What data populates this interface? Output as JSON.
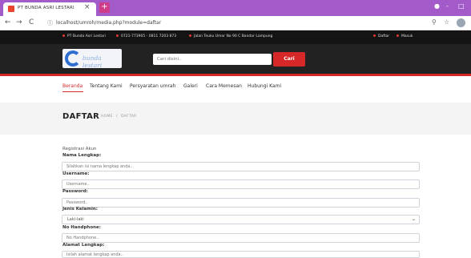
{
  "browser": {
    "tab_title": "PT BUNDA ASRI LESTARI",
    "tab_close": "×",
    "new_tab": "+",
    "url": "localhost/umroh/media.php?module=daftar",
    "back": "←",
    "forward": "→",
    "reload": "C",
    "url_icon": "ⓘ",
    "zoom_icon": "⚲",
    "star_icon": "☆",
    "win_minimize": "●",
    "win_restore": "-",
    "win_close": "□"
  },
  "infobar": {
    "company": "PT Bunda Asri Lestari",
    "phone": "0721-773905 - 0811 7203 873",
    "address": "Jalan Teuku Umar No 90 C Bandar Lampung",
    "register": "Daftar",
    "login": "Masuk"
  },
  "header": {
    "logo_text": "bunda lestari",
    "search_placeholder": "Cari disini..",
    "search_button": "Cari"
  },
  "menu": {
    "items": [
      "Beranda",
      "Tentang Kami",
      "Persyaratan umrah",
      "Galeri",
      "Cara Memesan",
      "Hubungi Kami"
    ]
  },
  "page": {
    "title": "DAFTAR",
    "breadcrumb_home": "HOME",
    "breadcrumb_sep": "/",
    "breadcrumb_current": "DAFTAR"
  },
  "form": {
    "caption": "Registrasi Akun",
    "nama_label": "Nama Lengkap:",
    "nama_placeholder": "Silahkan isi nama lengkap anda..",
    "username_label": "Username:",
    "username_placeholder": "Username..",
    "password_label": "Password:",
    "password_placeholder": "Password..",
    "gender_label": "Jenis Kelamin:",
    "gender_value": "Laki-laki",
    "gender_arrow": "⌄",
    "hp_label": "No Handphone:",
    "hp_placeholder": "No Handphone..",
    "alamat_label": "Alamat Lengkap:",
    "alamat_placeholder": "Isilah alamat lengkap anda.."
  },
  "colors": {
    "tabbar": "#a25bc8",
    "accent_red": "#d62828",
    "header_dark": "#222222"
  }
}
